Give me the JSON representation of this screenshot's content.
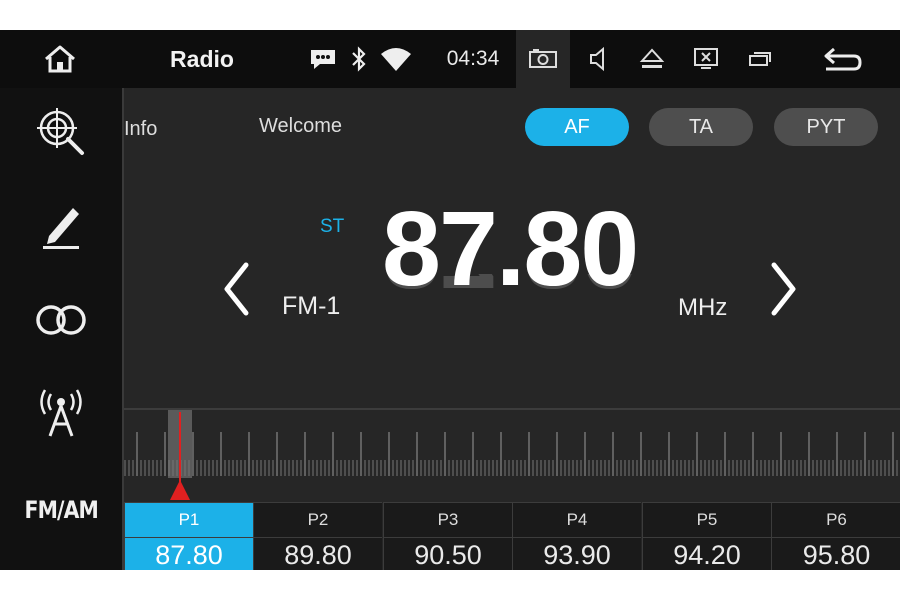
{
  "statusbar": {
    "title": "Radio",
    "time": "04:34",
    "icons": [
      "home-icon",
      "message-icon",
      "bluetooth-icon",
      "wifi-icon",
      "camera-icon",
      "volume-icon",
      "eject-icon",
      "screen-off-icon",
      "window-icon",
      "back-icon"
    ]
  },
  "sidebar": {
    "items": [
      {
        "icon": "scan-search-icon"
      },
      {
        "icon": "edit-icon"
      },
      {
        "icon": "stereo-icon"
      },
      {
        "icon": "antenna-icon"
      },
      {
        "label": "FM/AM"
      }
    ]
  },
  "main": {
    "info_label": "Info",
    "rds_text": "Welcome",
    "toggles": [
      {
        "label": "AF",
        "active": true
      },
      {
        "label": "TA",
        "active": false
      },
      {
        "label": "PYT",
        "active": false
      }
    ],
    "stereo": "ST",
    "band": "FM-1",
    "frequency": "87.80",
    "unit": "MHz",
    "tuner_position": 0.08
  },
  "presets": [
    {
      "label": "P1",
      "freq": "87.80",
      "active": true
    },
    {
      "label": "P2",
      "freq": "89.80",
      "active": false
    },
    {
      "label": "P3",
      "freq": "90.50",
      "active": false
    },
    {
      "label": "P4",
      "freq": "93.90",
      "active": false
    },
    {
      "label": "P5",
      "freq": "94.20",
      "active": false
    },
    {
      "label": "P6",
      "freq": "95.80",
      "active": false
    }
  ],
  "colors": {
    "accent": "#1cb1e8",
    "background": "#262626",
    "bar": "#0d0d0d",
    "needle": "#e02020"
  }
}
